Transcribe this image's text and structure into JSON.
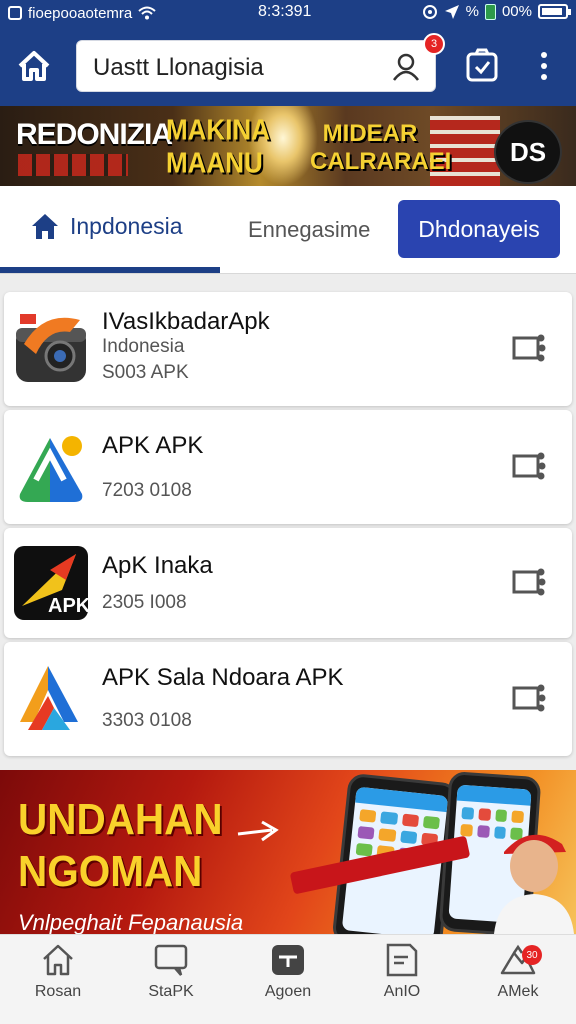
{
  "status_bar": {
    "carrier": "ﬁoepooaotemra",
    "time": "8:3:391",
    "percent_label": "%",
    "battery": "00%",
    "battery_level": 0.9
  },
  "header": {
    "search_text": "Uastt Llonagisia",
    "notification_count": "3"
  },
  "promo_banner": {
    "left_text": "REDONIZIA",
    "middle_text": "MAKINA MAANU",
    "right_text": "MIDEAR CALRARAEI",
    "logo_text": "DS",
    "colors": {
      "accent": "#f5d133",
      "background": "#3a2a1d"
    }
  },
  "tabs": [
    {
      "label": "Inpdonesia",
      "active": true
    },
    {
      "label": "Ennegasime",
      "active": false
    },
    {
      "label": "Dhdonayeis",
      "active": false
    }
  ],
  "apps": [
    {
      "title": "IVasIkbadarApk",
      "line1": "Indonesia",
      "line2": "S003 APK",
      "icon": "camera-app-icon"
    },
    {
      "title": "APK APK",
      "line1": "",
      "line2": "7203 0108",
      "icon": "green-blue-a-app-icon"
    },
    {
      "title": "ApK Inaka",
      "line1": "",
      "line2": "2305 I008",
      "icon": "yellow-apk-app-icon"
    },
    {
      "title": "APK Sala Ndoara APK",
      "line1": "",
      "line2": "3303 0108",
      "icon": "colorful-a-app-icon"
    }
  ],
  "ad_banner": {
    "headline_1": "UNDAHAN",
    "headline_2": "NGOMAN",
    "subtext": "Vnlpeghait Fepanausia",
    "colors": {
      "headline": "#f9d12b",
      "background": "#b4190f"
    }
  },
  "bottom_nav": [
    {
      "label": "Rosan",
      "icon": "home-icon"
    },
    {
      "label": "StaPK",
      "icon": "chat-icon"
    },
    {
      "label": "Agoen",
      "icon": "app-icon"
    },
    {
      "label": "AnIO",
      "icon": "document-icon"
    },
    {
      "label": "AMek",
      "icon": "mountain-icon",
      "badge": "30"
    }
  ],
  "colors": {
    "primary": "#1d3f86",
    "tab_button": "#2a44b0",
    "badge": "#e52424"
  }
}
